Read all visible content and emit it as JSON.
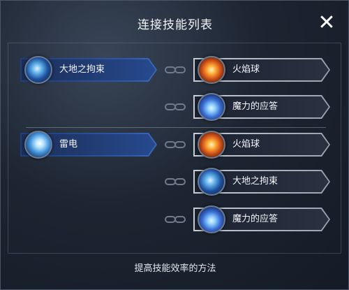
{
  "dialog": {
    "title": "连接技能列表",
    "close_label": "✕",
    "footer_link": "提高技能效率的方法"
  },
  "groups": [
    {
      "source": {
        "label": "大地之拘束",
        "icon": "earth-bind-icon"
      },
      "links": [
        {
          "label": "火焰球",
          "icon": "fireball-icon"
        },
        {
          "label": "魔力的应答",
          "icon": "mana-response-icon"
        }
      ]
    },
    {
      "source": {
        "label": "雷电",
        "icon": "lightning-icon"
      },
      "links": [
        {
          "label": "火焰球",
          "icon": "fireball-icon"
        },
        {
          "label": "大地之拘束",
          "icon": "earth-bind-icon"
        },
        {
          "label": "魔力的应答",
          "icon": "mana-response-icon"
        }
      ]
    }
  ],
  "colors": {
    "source_fill": "#264a8e",
    "linked_fill": "#2a3242",
    "border_light": "#c8ccd3"
  }
}
